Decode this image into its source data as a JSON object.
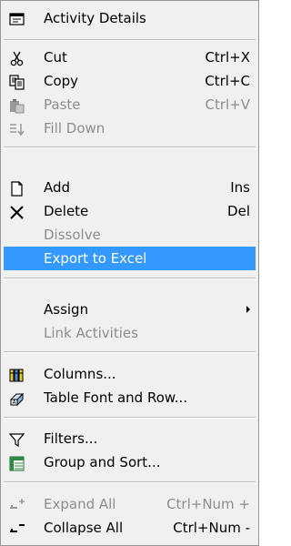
{
  "menu": {
    "activity_details": {
      "label": "Activity Details",
      "icon": "activity-details-icon"
    },
    "cut": {
      "label": "Cut",
      "shortcut": "Ctrl+X",
      "icon": "scissors-icon"
    },
    "copy": {
      "label": "Copy",
      "shortcut": "Ctrl+C",
      "icon": "copy-icon"
    },
    "paste": {
      "label": "Paste",
      "shortcut": "Ctrl+V",
      "icon": "paste-icon",
      "disabled": true
    },
    "fill_down": {
      "label": "Fill Down",
      "icon": "fill-down-icon",
      "disabled": true
    },
    "add": {
      "label": "Add",
      "shortcut": "Ins",
      "icon": "new-document-icon"
    },
    "delete": {
      "label": "Delete",
      "shortcut": "Del",
      "icon": "delete-x-icon"
    },
    "dissolve": {
      "label": "Dissolve",
      "disabled": true
    },
    "export_to_excel": {
      "label": "Export to Excel",
      "selected": true
    },
    "assign": {
      "label": "Assign",
      "has_submenu": true
    },
    "link_activities": {
      "label": "Link Activities",
      "disabled": true
    },
    "columns": {
      "label": "Columns...",
      "icon": "columns-icon"
    },
    "table_font": {
      "label": "Table Font and Row...",
      "icon": "table-font-icon"
    },
    "filters": {
      "label": "Filters...",
      "icon": "filter-funnel-icon"
    },
    "group_sort": {
      "label": "Group and Sort...",
      "icon": "group-sort-icon"
    },
    "expand_all": {
      "label": "Expand All",
      "shortcut": "Ctrl+Num +",
      "icon": "expand-all-icon",
      "disabled": true
    },
    "collapse_all": {
      "label": "Collapse All",
      "shortcut": "Ctrl+Num -",
      "icon": "collapse-all-icon"
    }
  },
  "colors": {
    "menu_bg": "#f0f0f0",
    "selection": "#3399ff",
    "disabled_text": "#8d8d8d",
    "separator": "#bdbdbd"
  }
}
